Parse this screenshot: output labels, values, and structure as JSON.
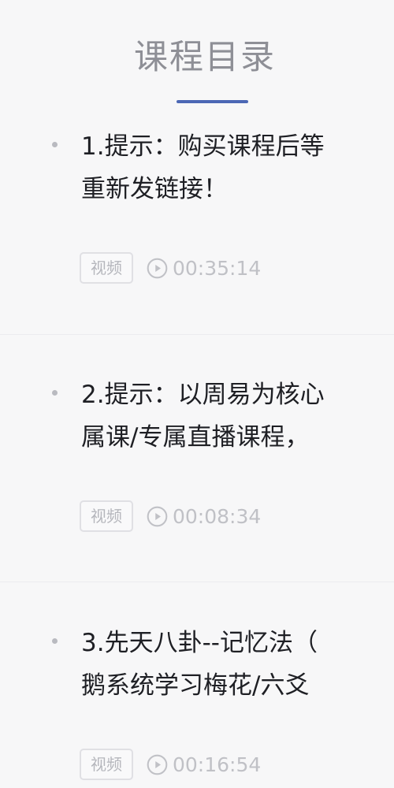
{
  "header": {
    "title": "课程目录"
  },
  "lessons": [
    {
      "title_line1": "1.提示：购买课程后等",
      "title_line2": "重新发链接！",
      "type": "视频",
      "duration": "00:35:14"
    },
    {
      "title_line1": "2.提示：以周易为核心",
      "title_line2": "属课/专属直播课程，",
      "type": "视频",
      "duration": "00:08:34"
    },
    {
      "title_line1": "3.先天八卦--记忆法（",
      "title_line2": "鹅系统学习梅花/六爻",
      "type": "视频",
      "duration": "00:16:54"
    }
  ],
  "icons": {
    "duration_icon": "play-circle-icon"
  },
  "colors": {
    "accent": "#4c68b5",
    "title_text": "#1e1f24",
    "muted_text": "#c0c1c6"
  }
}
